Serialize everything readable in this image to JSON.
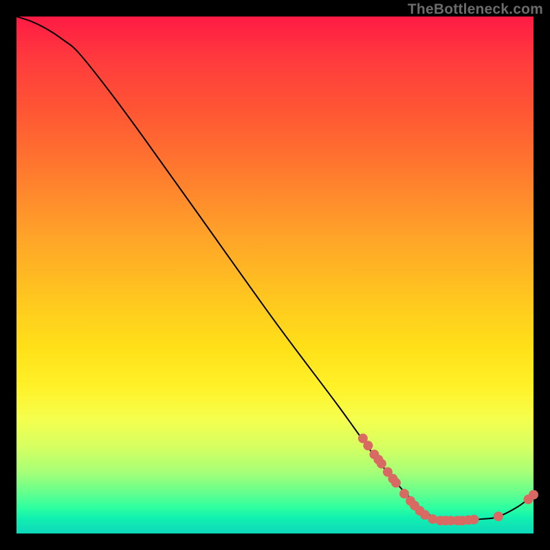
{
  "attribution": "TheBottleneck.com",
  "colors": {
    "point": "#d86a63",
    "curve": "#000000"
  },
  "chart_data": {
    "type": "line",
    "title": "",
    "xlabel": "",
    "ylabel": "",
    "xlim": [
      0,
      100
    ],
    "ylim": [
      0,
      100
    ],
    "grid": false,
    "legend": false,
    "curve": [
      {
        "x": 0,
        "y": 100
      },
      {
        "x": 3,
        "y": 99
      },
      {
        "x": 6,
        "y": 97.5
      },
      {
        "x": 9,
        "y": 95.5
      },
      {
        "x": 12,
        "y": 93
      },
      {
        "x": 18,
        "y": 85.5
      },
      {
        "x": 25,
        "y": 76
      },
      {
        "x": 35,
        "y": 62
      },
      {
        "x": 50,
        "y": 41
      },
      {
        "x": 62,
        "y": 25
      },
      {
        "x": 70,
        "y": 14
      },
      {
        "x": 76,
        "y": 7
      },
      {
        "x": 80,
        "y": 3.5
      },
      {
        "x": 83,
        "y": 2.5
      },
      {
        "x": 86,
        "y": 2.5
      },
      {
        "x": 90,
        "y": 2.8
      },
      {
        "x": 93,
        "y": 3.2
      },
      {
        "x": 97,
        "y": 5.2
      },
      {
        "x": 100,
        "y": 7.5
      }
    ],
    "points": [
      {
        "x": 67,
        "y": 18.4
      },
      {
        "x": 68,
        "y": 17.0
      },
      {
        "x": 69.2,
        "y": 15.3
      },
      {
        "x": 70,
        "y": 14.3
      },
      {
        "x": 70.6,
        "y": 13.5
      },
      {
        "x": 71.8,
        "y": 11.9
      },
      {
        "x": 72.8,
        "y": 10.6
      },
      {
        "x": 73.4,
        "y": 9.8
      },
      {
        "x": 75,
        "y": 7.7
      },
      {
        "x": 76.2,
        "y": 6.3
      },
      {
        "x": 77,
        "y": 5.4
      },
      {
        "x": 78,
        "y": 4.4
      },
      {
        "x": 79,
        "y": 3.6
      },
      {
        "x": 80.5,
        "y": 2.8
      },
      {
        "x": 82,
        "y": 2.5
      },
      {
        "x": 83,
        "y": 2.5
      },
      {
        "x": 84,
        "y": 2.5
      },
      {
        "x": 85.3,
        "y": 2.5
      },
      {
        "x": 86.2,
        "y": 2.5
      },
      {
        "x": 87.4,
        "y": 2.6
      },
      {
        "x": 88.5,
        "y": 2.7
      },
      {
        "x": 93.2,
        "y": 3.3
      },
      {
        "x": 99,
        "y": 6.6
      },
      {
        "x": 100,
        "y": 7.5
      }
    ]
  }
}
